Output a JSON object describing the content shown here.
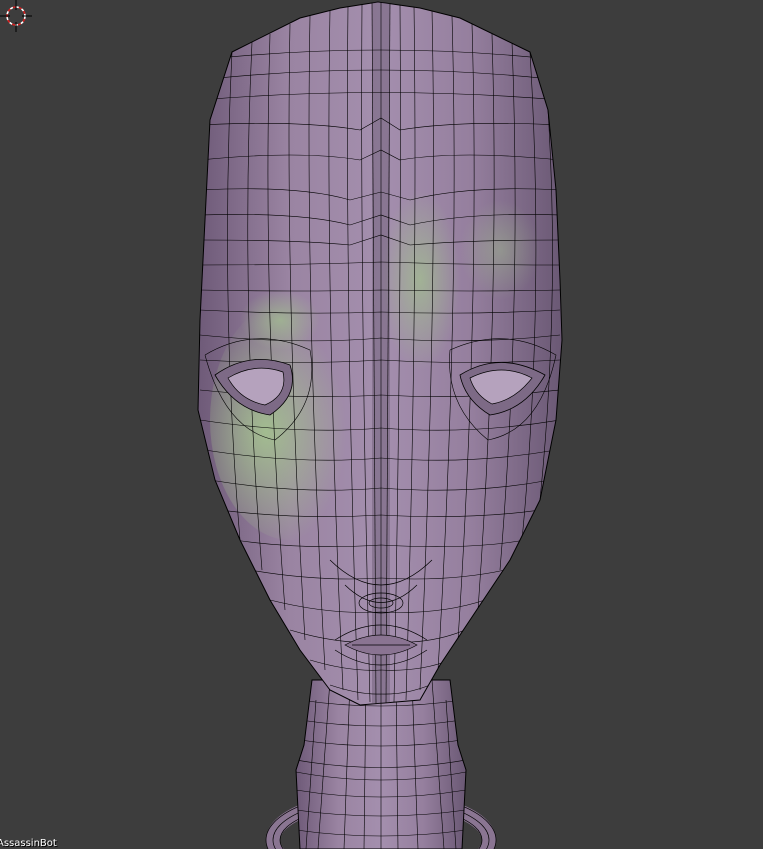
{
  "viewport": {
    "object_name": "AssassinBot",
    "background_color": "#3d3d3d",
    "mesh_color": "#9a84a2",
    "mesh_highlight_color": "#9fc18c",
    "wire_color": "#000000",
    "cursor_color": "#d42020"
  },
  "icons": {
    "cursor": "3d-cursor-icon"
  }
}
